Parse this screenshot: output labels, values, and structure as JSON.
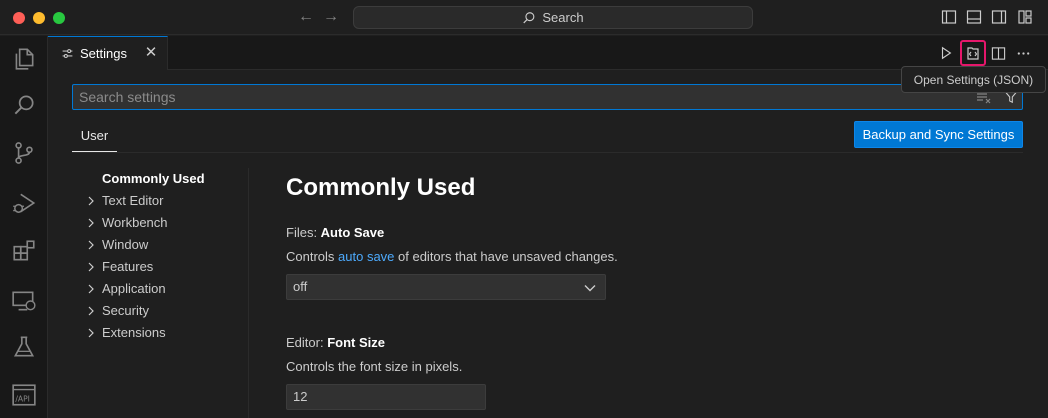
{
  "titlebar": {
    "search_label": "Search"
  },
  "tab": {
    "label": "Settings"
  },
  "tooltip": {
    "text": "Open Settings (JSON)"
  },
  "search": {
    "placeholder": "Search settings",
    "value": ""
  },
  "scope": {
    "user_label": "User"
  },
  "sync_button": {
    "label": "Backup and Sync Settings"
  },
  "toc": {
    "items": [
      {
        "label": "Commonly Used"
      },
      {
        "label": "Text Editor"
      },
      {
        "label": "Workbench"
      },
      {
        "label": "Window"
      },
      {
        "label": "Features"
      },
      {
        "label": "Application"
      },
      {
        "label": "Security"
      },
      {
        "label": "Extensions"
      }
    ]
  },
  "content": {
    "section_title": "Commonly Used",
    "auto_save": {
      "category": "Files: ",
      "name": "Auto Save",
      "desc_before": "Controls ",
      "desc_link": "auto save",
      "desc_after": " of editors that have unsaved changes.",
      "value": "off"
    },
    "font_size": {
      "category": "Editor: ",
      "name": "Font Size",
      "desc": "Controls the font size in pixels.",
      "value": "12"
    }
  },
  "icons": {
    "nav_back": "arrow-left-icon",
    "nav_forward": "arrow-right-icon",
    "search": "search-icon",
    "explorer": "files-icon",
    "source_control": "source-control-icon",
    "run_debug": "run-debug-icon",
    "extensions": "extensions-icon",
    "remote_explorer": "remote-explorer-icon",
    "testing": "beaker-icon",
    "api": "api-icon"
  },
  "colors": {
    "accent": "#0078d4",
    "highlight_border": "#e5176b",
    "link": "#4daafc",
    "background": "#1f1f1f",
    "activity_bar": "#181818"
  }
}
